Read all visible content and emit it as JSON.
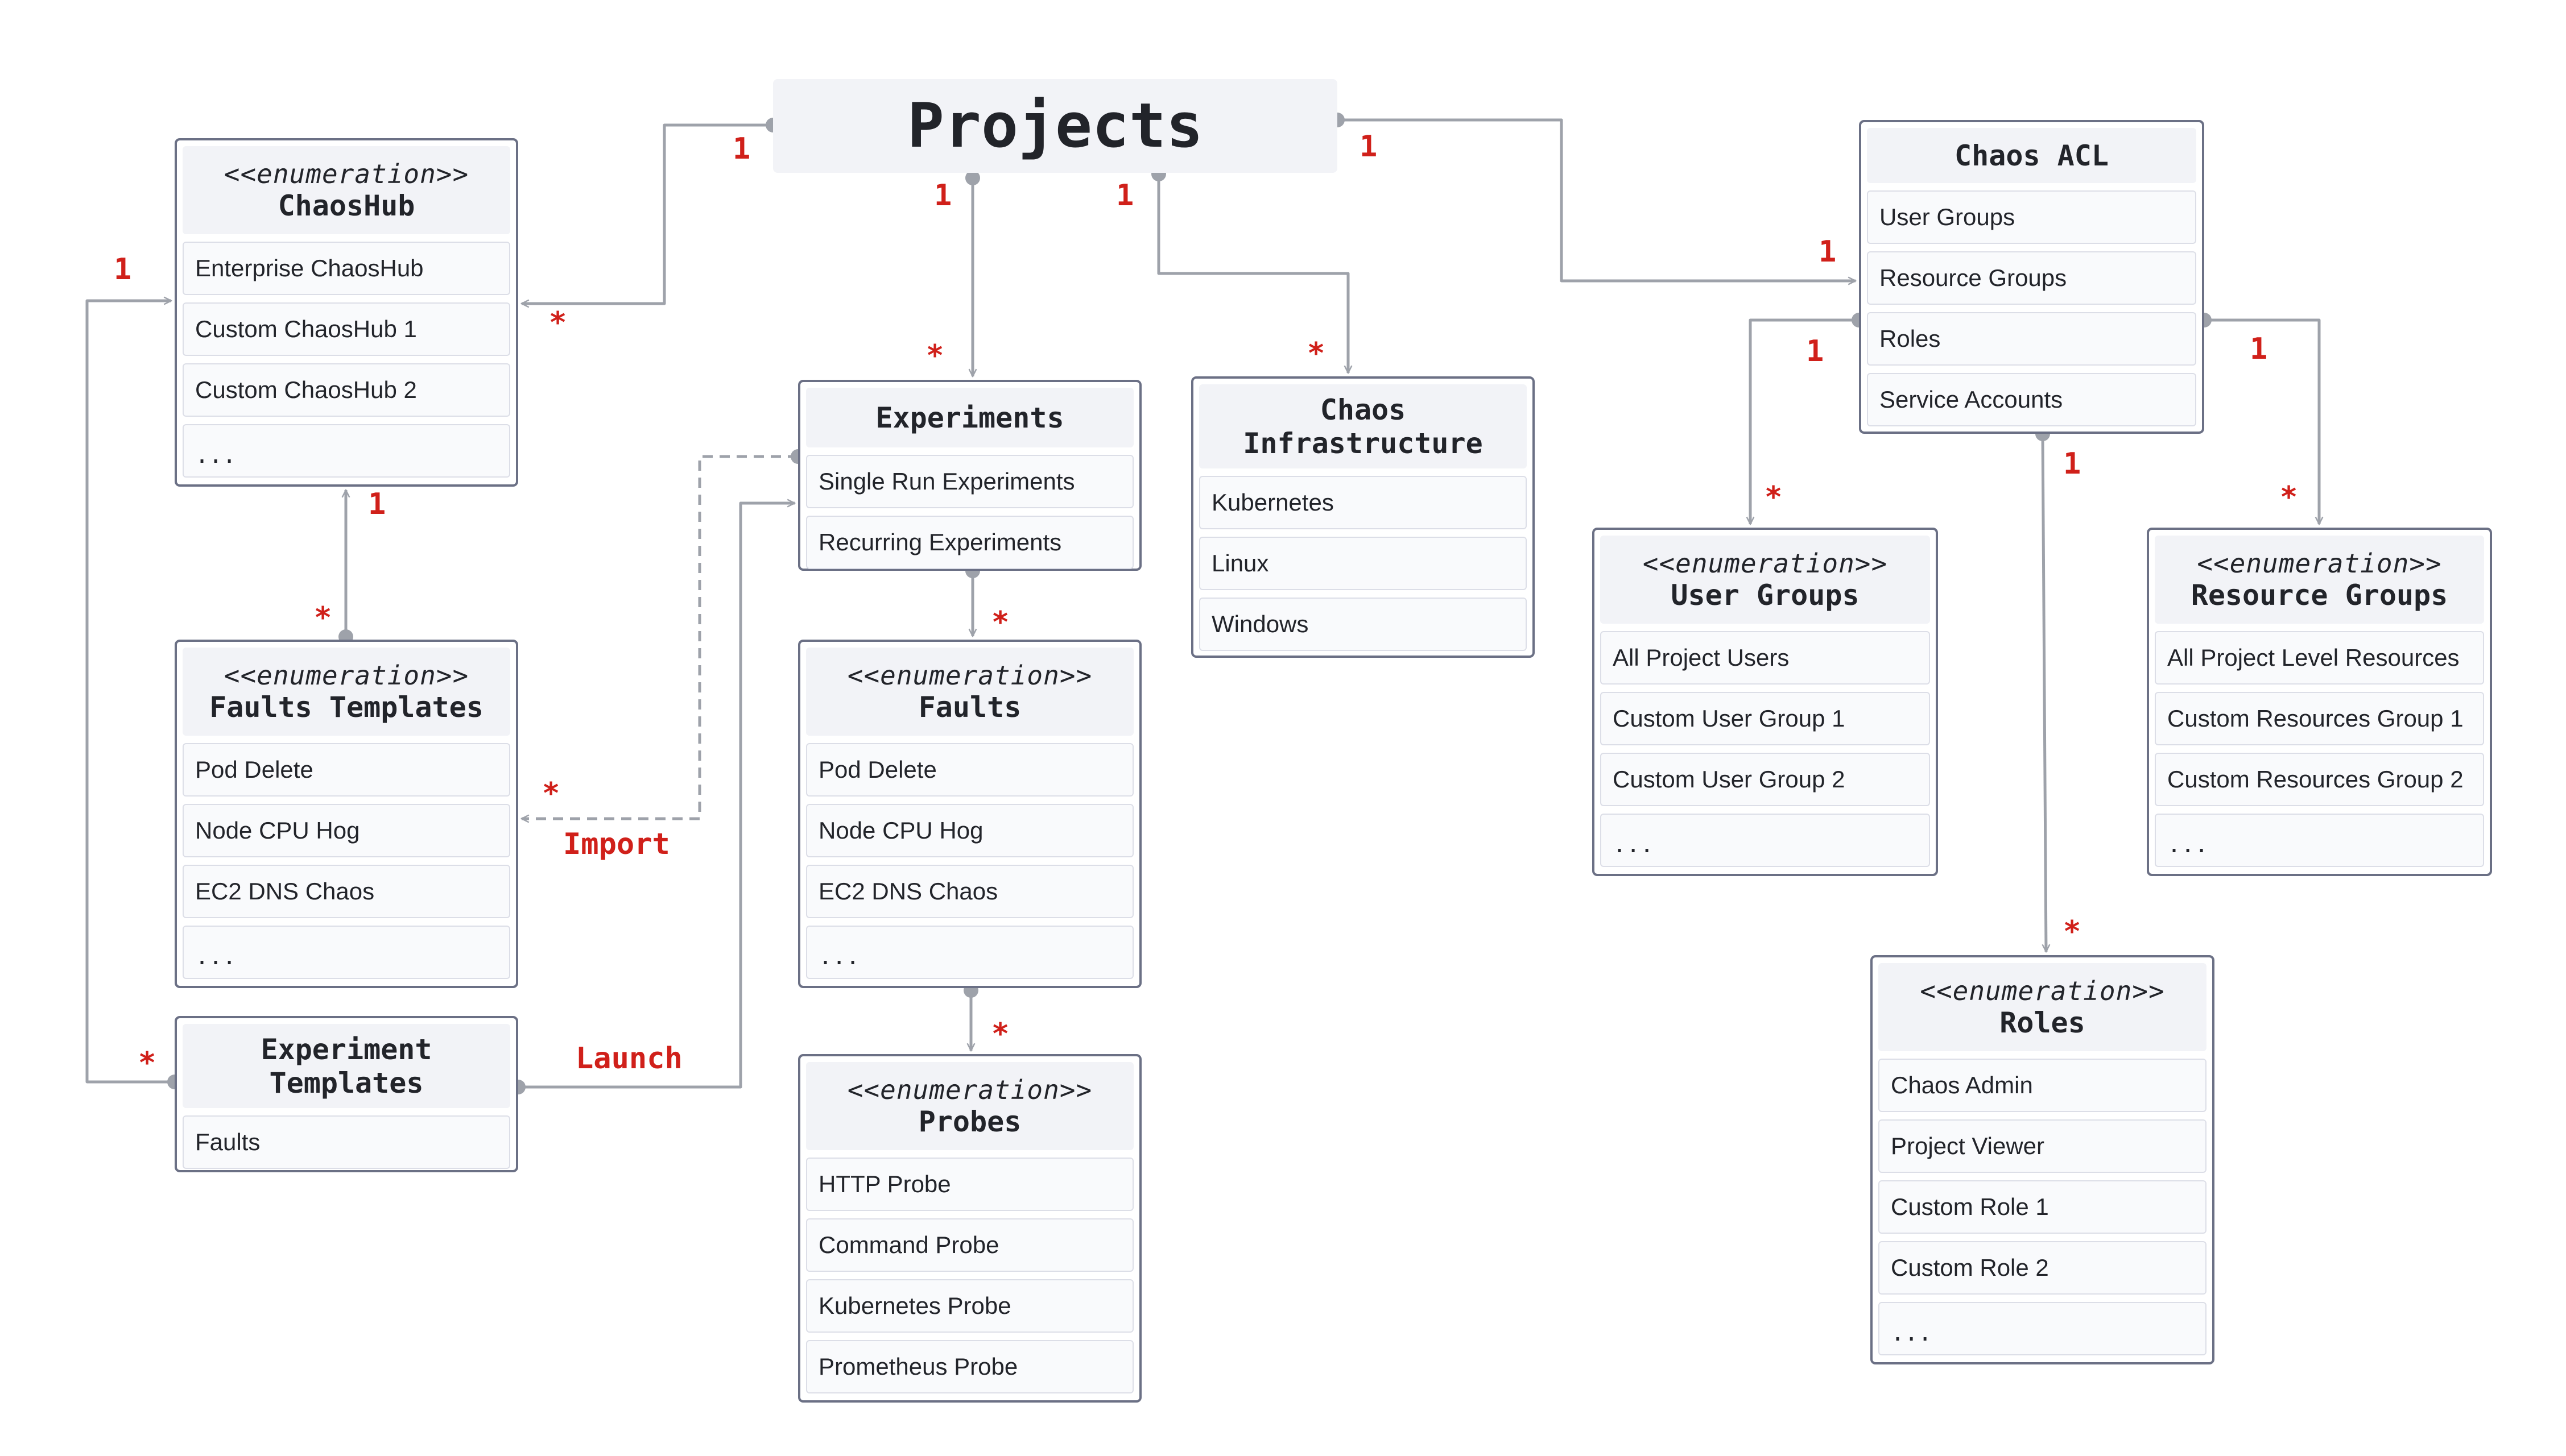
{
  "diagram": {
    "type": "UML class diagram",
    "accent_color": "#d0201a",
    "connector_color": "#9ea2aa",
    "border_color": "#6b7085"
  },
  "nodes": {
    "projects": {
      "title": "Projects"
    },
    "chaoshub": {
      "stereotype": "<<enumeration>>",
      "title": "ChaosHub",
      "items": [
        "Enterprise ChaosHub",
        "Custom ChaosHub 1",
        "Custom ChaosHub 2",
        "..."
      ]
    },
    "faults_templates": {
      "stereotype": "<<enumeration>>",
      "title": "Faults Templates",
      "items": [
        "Pod Delete",
        "Node CPU Hog",
        "EC2 DNS Chaos",
        "..."
      ]
    },
    "experiment_templates": {
      "title_line1": "Experiment",
      "title_line2": "Templates",
      "items": [
        "Faults"
      ]
    },
    "experiments": {
      "title": "Experiments",
      "items": [
        "Single Run Experiments",
        "Recurring Experiments"
      ]
    },
    "faults": {
      "stereotype": "<<enumeration>>",
      "title": "Faults",
      "items": [
        "Pod Delete",
        "Node CPU Hog",
        "EC2 DNS Chaos",
        "..."
      ]
    },
    "probes": {
      "stereotype": "<<enumeration>>",
      "title": "Probes",
      "items": [
        "HTTP Probe",
        "Command Probe",
        "Kubernetes Probe",
        "Prometheus Probe"
      ]
    },
    "chaos_infrastructure": {
      "title_line1": "Chaos",
      "title_line2": "Infrastructure",
      "items": [
        "Kubernetes",
        "Linux",
        "Windows"
      ]
    },
    "chaos_acl": {
      "title": "Chaos ACL",
      "items": [
        "User Groups",
        "Resource Groups",
        "Roles",
        "Service Accounts"
      ]
    },
    "user_groups": {
      "stereotype": "<<enumeration>>",
      "title": "User Groups",
      "items": [
        "All Project Users",
        "Custom User Group 1",
        "Custom User Group 2",
        "..."
      ]
    },
    "resource_groups": {
      "stereotype": "<<enumeration>>",
      "title": "Resource Groups",
      "items": [
        "All Project Level Resources",
        "Custom Resources Group 1",
        "Custom Resources Group 2",
        "..."
      ]
    },
    "roles": {
      "stereotype": "<<enumeration>>",
      "title": "Roles",
      "items": [
        "Chaos Admin",
        "Project Viewer",
        "Custom Role 1",
        "Custom Role 2",
        "..."
      ]
    }
  },
  "relationships": [
    {
      "from": "Projects",
      "to": "ChaosHub",
      "from_mult": "1",
      "to_mult": "*",
      "style": "solid"
    },
    {
      "from": "Projects",
      "to": "Experiments",
      "from_mult": "1",
      "to_mult": "*",
      "style": "solid"
    },
    {
      "from": "Projects",
      "to": "Chaos Infrastructure",
      "from_mult": "1",
      "to_mult": "*",
      "style": "solid"
    },
    {
      "from": "Projects",
      "to": "Chaos ACL",
      "from_mult": "1",
      "to_mult": "1",
      "style": "solid"
    },
    {
      "from": "Faults Templates",
      "to": "ChaosHub",
      "from_mult": "*",
      "to_mult": "1",
      "style": "solid"
    },
    {
      "from": "Experiment Templates",
      "to": "ChaosHub",
      "from_mult": "*",
      "to_mult": "1",
      "style": "solid"
    },
    {
      "from": "Experiments",
      "to": "Faults Templates",
      "to_mult": "*",
      "label": "Import",
      "style": "dashed"
    },
    {
      "from": "Experiment Templates",
      "to": "Experiments",
      "label": "Launch",
      "style": "solid"
    },
    {
      "from": "Experiments",
      "to": "Faults",
      "to_mult": "*",
      "style": "solid"
    },
    {
      "from": "Faults",
      "to": "Probes",
      "to_mult": "*",
      "style": "solid"
    },
    {
      "from": "Chaos ACL",
      "to": "User Groups",
      "from_mult": "1",
      "to_mult": "*",
      "style": "solid"
    },
    {
      "from": "Chaos ACL",
      "to": "Resource Groups",
      "from_mult": "1",
      "to_mult": "*",
      "style": "solid"
    },
    {
      "from": "Chaos ACL",
      "to": "Roles",
      "from_mult": "1",
      "to_mult": "*",
      "style": "solid"
    }
  ],
  "labels": {
    "one": "1",
    "many": "*",
    "import": "Import",
    "launch": "Launch"
  }
}
